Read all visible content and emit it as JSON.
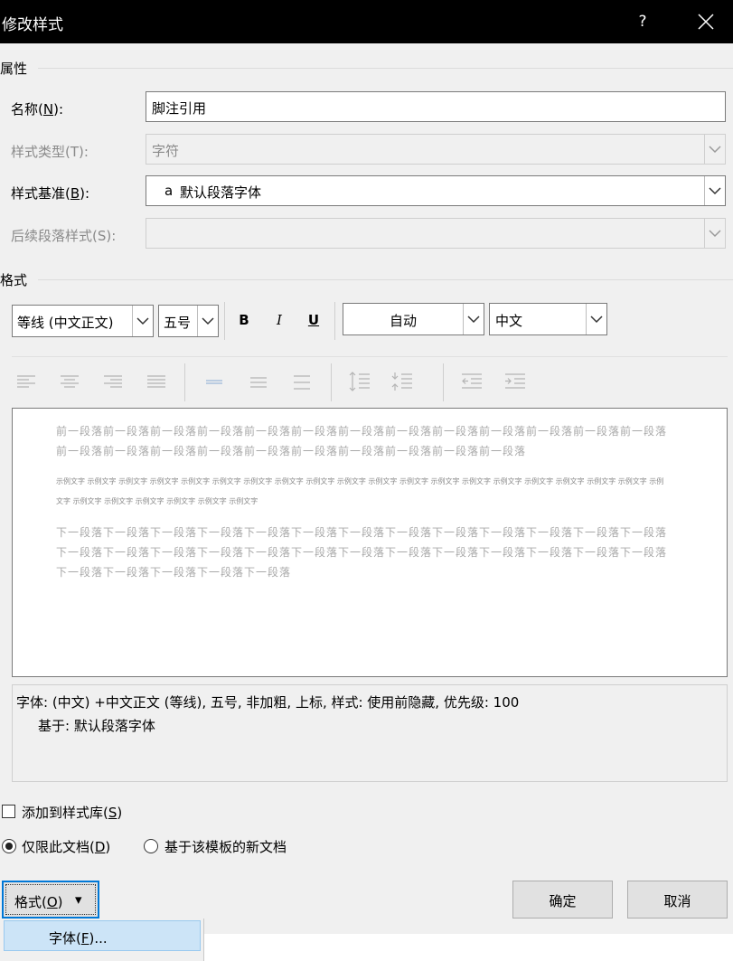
{
  "window": {
    "title": "修改样式",
    "help": "?",
    "close": "✕"
  },
  "properties": {
    "section": "属性",
    "name_label": "名称(N):",
    "name_value": "脚注引用",
    "type_label": "样式类型(T):",
    "type_value": "字符",
    "based_label": "样式基准(B):",
    "based_icon": "a",
    "based_value": "默认段落字体",
    "next_label": "后续段落样式(S):",
    "next_value": ""
  },
  "format": {
    "section": "格式",
    "font_value": "等线 (中文正文)",
    "size_value": "五号",
    "bold": "B",
    "italic": "I",
    "underline": "U",
    "color_value": "自动",
    "lang_value": "中文"
  },
  "preview": {
    "prev_text": "前一段落前一段落前一段落前一段落前一段落前一段落前一段落前一段落前一段落前一段落前一段落前一段落前一段落前一段落前一段落前一段落前一段落前一段落前一段落前一段落前一段落前一段落前一段落",
    "sample_text": "示例文字 示例文字 示例文字 示例文字 示例文字 示例文字 示例文字 示例文字 示例文字 示例文字 示例文字 示例文字 示例文字 示例文字 示例文字 示例文字 示例文字 示例文字 示例文字 示例文字 示例文字 示例文字 示例文字 示例文字 示例文字 示例文字",
    "next_text": "下一段落下一段落下一段落下一段落下一段落下一段落下一段落下一段落下一段落下一段落下一段落下一段落下一段落下一段落下一段落下一段落下一段落下一段落下一段落下一段落下一段落下一段落下一段落下一段落下一段落下一段落下一段落下一段落下一段落下一段落下一段落"
  },
  "description": {
    "line1": "字体: (中文) +中文正文 (等线), 五号, 非加粗, 上标, 样式: 使用前隐藏, 优先级: 100",
    "line2": "基于: 默认段落字体"
  },
  "options": {
    "add_to_gallery": "添加到样式库(S)",
    "only_this_doc": "仅限此文档(D)",
    "new_docs": "基于该模板的新文档"
  },
  "buttons": {
    "format": "格式(O)",
    "format_arrow": "▾",
    "ok": "确定",
    "cancel": "取消"
  },
  "menu": {
    "font_item": "字体(F)..."
  }
}
